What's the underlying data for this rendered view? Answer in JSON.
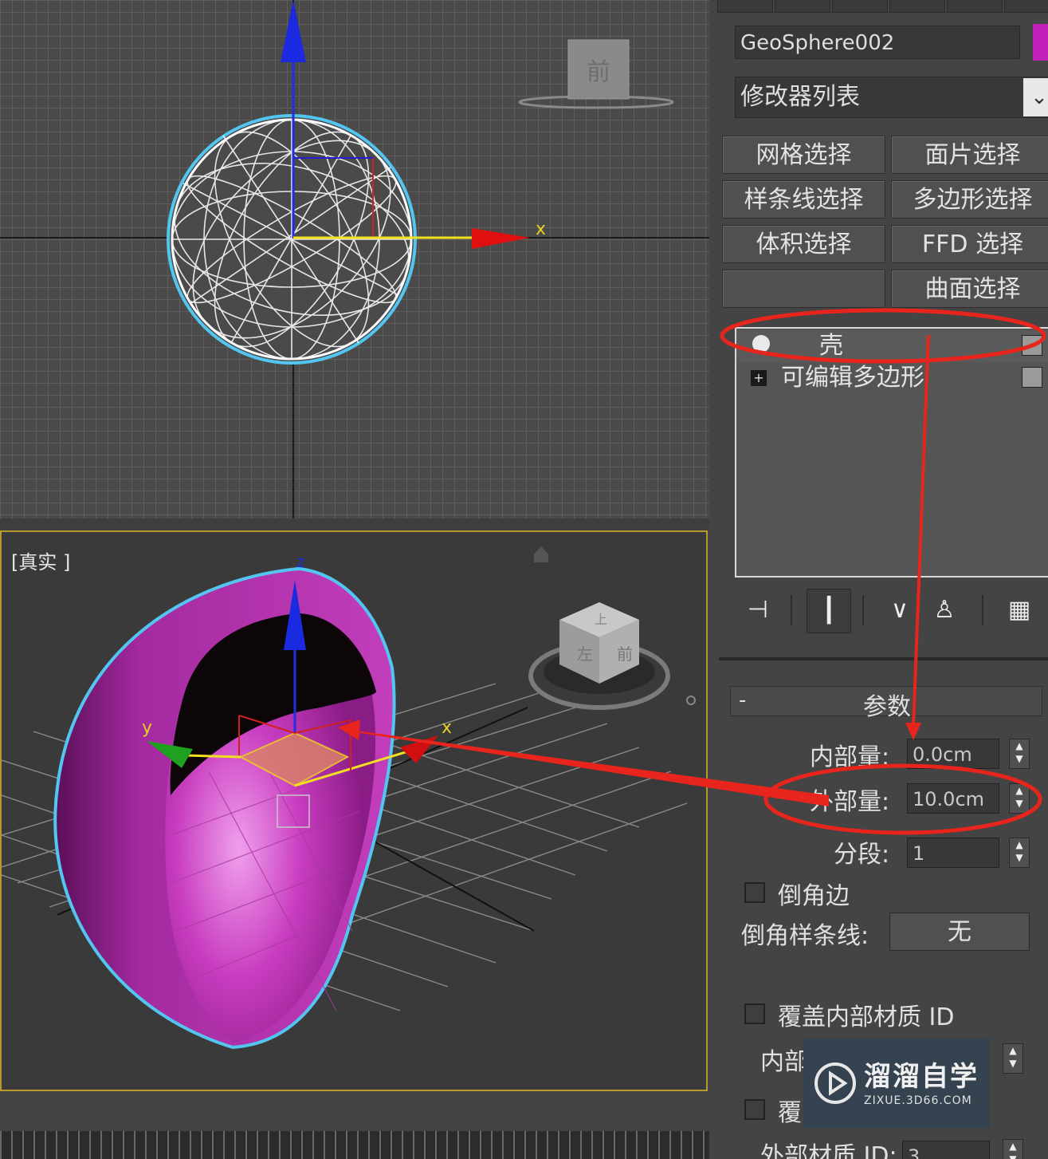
{
  "viewport_top": {
    "view_cube_label": "前",
    "axis_x_label": "x"
  },
  "viewport_perspective": {
    "label": "[真实 ]",
    "axis_x_label": "x",
    "axis_y_label": "y",
    "axis_z_label": "z",
    "view_cube_front": "前",
    "view_cube_left": "左",
    "view_cube_top": "上"
  },
  "panel": {
    "object_name": "GeoSphere002",
    "object_color": "#c020b8",
    "modifier_list_label": "修改器列表",
    "modifier_buttons": [
      "网格选择",
      "面片选择",
      "样条线选择",
      "多边形选择",
      "体积选择",
      "FFD 选择",
      "",
      "曲面选择"
    ],
    "stack": [
      {
        "label": "壳"
      },
      {
        "label": "可编辑多边形"
      }
    ],
    "params": {
      "title": "参数",
      "collapse": "-",
      "inner_amount_label": "内部量:",
      "inner_amount_value": "0.0cm",
      "outer_amount_label": "外部量:",
      "outer_amount_value": "10.0cm",
      "segments_label": "分段:",
      "segments_value": "1",
      "bevel_edges_label": "倒角边",
      "bevel_spline_label": "倒角样条线:",
      "bevel_spline_value": "无",
      "override_inner_mat_label": "覆盖内部材质 ID",
      "inner_mat_label": "内部",
      "override_outer_label": "覆",
      "outer_mat_label": "外部材质 ID:",
      "outer_mat_value": "3"
    }
  },
  "watermark": {
    "brand_cn": "溜溜自学",
    "brand_url": "ZIXUE.3D66.COM"
  },
  "annotation_color": "#e8251c"
}
